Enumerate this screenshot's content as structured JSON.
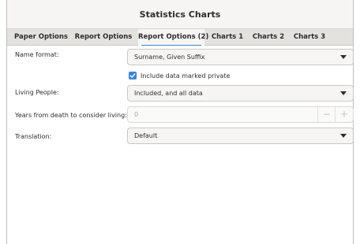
{
  "window": {
    "title": "Statistics Charts"
  },
  "tabs": [
    {
      "label": "Paper Options"
    },
    {
      "label": "Report Options"
    },
    {
      "label": "Report Options (2)"
    },
    {
      "label": "Charts 1"
    },
    {
      "label": "Charts 2"
    },
    {
      "label": "Charts 3"
    }
  ],
  "active_tab": "Report Options (2)",
  "form": {
    "name_format": {
      "label": "Name format:",
      "value": "Surname, Given Suffix"
    },
    "private": {
      "label": "Include data marked private",
      "checked": true
    },
    "living": {
      "label": "Living People:",
      "value": "Included, and all data"
    },
    "years": {
      "label": "Years from death to consider living:",
      "value": "0",
      "minus": "−",
      "plus": "+"
    },
    "translation": {
      "label": "Translation:",
      "value": "Default"
    }
  },
  "colors": {
    "accent": "#3584e4"
  },
  "icons": {
    "dropdown": "chevron-down-icon",
    "check": "check-icon"
  }
}
